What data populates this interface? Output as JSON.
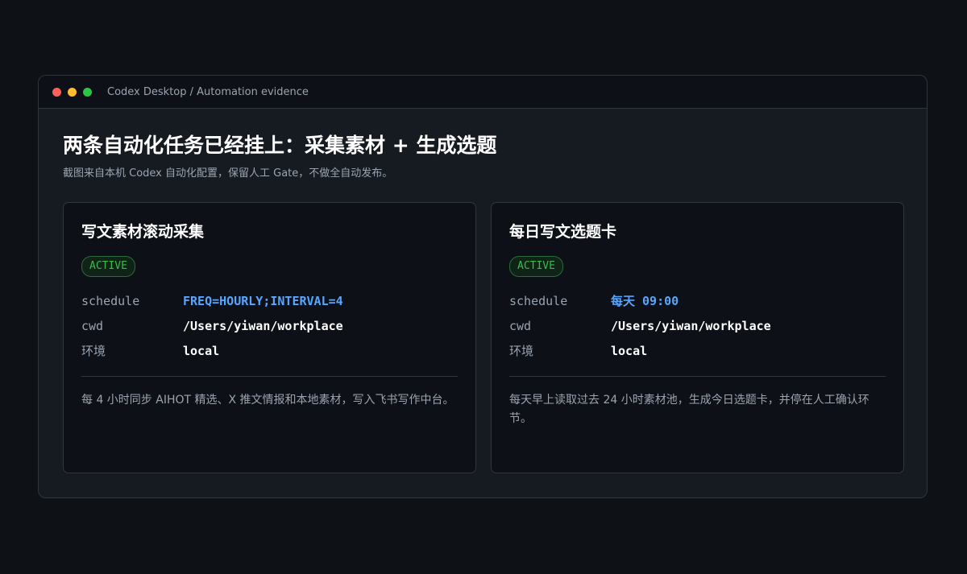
{
  "window": {
    "title": "Codex Desktop / Automation evidence"
  },
  "header": {
    "title": "两条自动化任务已经挂上：采集素材 + 生成选题",
    "subtitle": "截图来自本机 Codex 自动化配置，保留人工 Gate，不做全自动发布。"
  },
  "cards": [
    {
      "title": "写文素材滚动采集",
      "status": "ACTIVE",
      "fields": [
        {
          "key": "schedule",
          "value": "FREQ=HOURLY;INTERVAL=4"
        },
        {
          "key": "cwd",
          "value": "/Users/yiwan/workplace"
        },
        {
          "key": "环境",
          "value": "local"
        }
      ],
      "description": "每 4 小时同步 AIHOT 精选、X 推文情报和本地素材，写入飞书写作中台。"
    },
    {
      "title": "每日写文选题卡",
      "status": "ACTIVE",
      "fields": [
        {
          "key": "schedule",
          "value": "每天 09:00"
        },
        {
          "key": "cwd",
          "value": "/Users/yiwan/workplace"
        },
        {
          "key": "环境",
          "value": "local"
        }
      ],
      "description": "每天早上读取过去 24 小时素材池，生成今日选题卡，并停在人工确认环节。"
    }
  ],
  "colors": {
    "background": "#0e1116",
    "window": "#161b22",
    "card": "#0d1117",
    "accent": "#58a6ff",
    "active_green": "#3fb950"
  }
}
